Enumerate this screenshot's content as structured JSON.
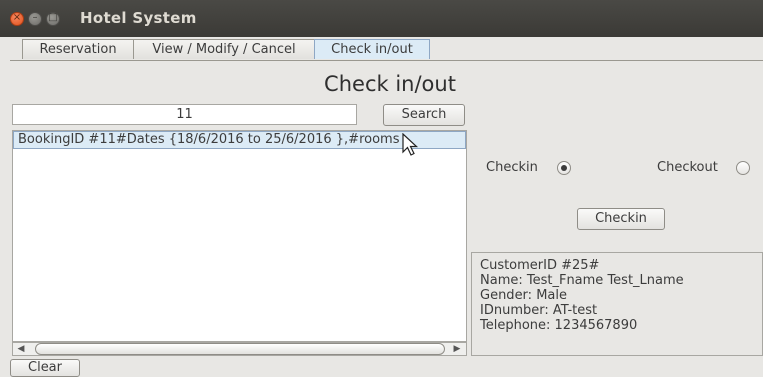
{
  "window": {
    "title": "Hotel System"
  },
  "tabs": [
    {
      "label": "Reservation"
    },
    {
      "label": "View / Modify / Cancel"
    },
    {
      "label": "Check in/out"
    }
  ],
  "main": {
    "heading": "Check in/out",
    "search": {
      "value": "11",
      "button_label": "Search"
    },
    "results": [
      "BookingID #11#Dates {18/6/2016 to 25/6/2016 },#rooms"
    ],
    "clear_label": "Clear"
  },
  "side": {
    "checkin_label": "Checkin",
    "checkout_label": "Checkout",
    "selected": "checkin",
    "action_button_label": "Checkin",
    "customer_info": [
      "CustomerID #25#",
      "Name: Test_Fname Test_Lname",
      "Gender: Male",
      "IDnumber: AT-test",
      "Telephone: 1234567890"
    ]
  },
  "colors": {
    "titlebar": "#3b3a36",
    "selection": "#dcebf6",
    "close_button": "#e2521d"
  }
}
